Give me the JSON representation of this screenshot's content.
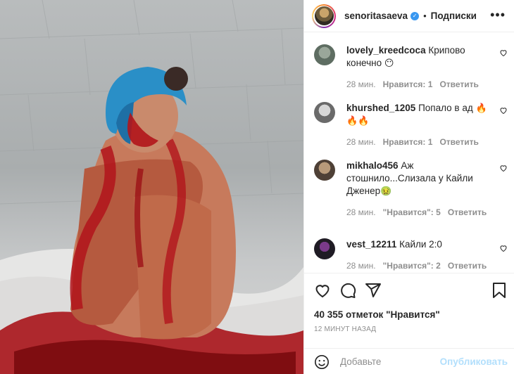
{
  "post": {
    "username": "senoritasaeva",
    "verified_mark": "✓",
    "dot": "•",
    "follow_label": "Подписки",
    "more_label": "•••",
    "likes": "40 355 отметок \"Нравится\"",
    "time": "12 МИНУТ НАЗАД",
    "add_comment_placeholder": "Добавьте комментарий...",
    "add_comment_visible": "Добавьте",
    "publish_label": "Опубликовать"
  },
  "comments": [
    {
      "user": "lovely_kreedcoca",
      "text": "Криповое конечно",
      "text_line1": "Крипово",
      "text_line2": "конечно",
      "emoji": "😶",
      "time": "28 мин.",
      "likes": "Нравится: 1",
      "reply": "Ответить"
    },
    {
      "user": "khurshed_1205",
      "text_line1": "Попало в ад",
      "emoji_line1": "🔥",
      "emoji_line2": "🔥🔥",
      "time": "28 мин.",
      "likes": "Нравится: 1",
      "reply": "Ответить"
    },
    {
      "user": "mikhalo456",
      "text_line1": "Аж",
      "text_line2": "стошнило...Слизала у Кайли",
      "text_line3": "Дженер",
      "emoji": "🤢",
      "time": "28 мин.",
      "likes": "\"Нравится\": 5",
      "reply": "Ответить"
    },
    {
      "user": "vest_12211",
      "text_line1": "Кайли 2:0",
      "time": "28 мин.",
      "likes": "\"Нравится\": 2",
      "reply": "Ответить"
    }
  ],
  "icons": [
    "heart-icon",
    "comment-icon",
    "share-icon",
    "bookmark-icon",
    "emoji-icon",
    "more-icon"
  ],
  "colors": {
    "link_disabled": "#b2dffc",
    "muted": "#8e8e8e",
    "text": "#262626",
    "verified": "#3897f0"
  }
}
